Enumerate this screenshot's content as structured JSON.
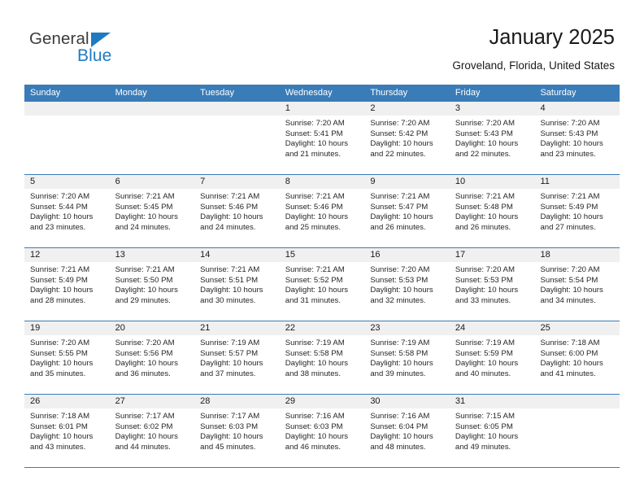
{
  "logo": {
    "word1": "General",
    "word2": "Blue",
    "triangle_color": "#1f7ac0",
    "word1_color": "#3b3b3b",
    "word2_color": "#1f7ac0"
  },
  "header": {
    "title": "January 2025",
    "subtitle": "Groveland, Florida, United States"
  },
  "theme": {
    "header_bar": "#3a7cb8",
    "date_band": "#f0f0f0",
    "text": "#262626"
  },
  "weekdays": [
    "Sunday",
    "Monday",
    "Tuesday",
    "Wednesday",
    "Thursday",
    "Friday",
    "Saturday"
  ],
  "weeks": [
    [
      {
        "day": "",
        "lines": []
      },
      {
        "day": "",
        "lines": []
      },
      {
        "day": "",
        "lines": []
      },
      {
        "day": "1",
        "lines": [
          "Sunrise: 7:20 AM",
          "Sunset: 5:41 PM",
          "Daylight: 10 hours",
          "and 21 minutes."
        ]
      },
      {
        "day": "2",
        "lines": [
          "Sunrise: 7:20 AM",
          "Sunset: 5:42 PM",
          "Daylight: 10 hours",
          "and 22 minutes."
        ]
      },
      {
        "day": "3",
        "lines": [
          "Sunrise: 7:20 AM",
          "Sunset: 5:43 PM",
          "Daylight: 10 hours",
          "and 22 minutes."
        ]
      },
      {
        "day": "4",
        "lines": [
          "Sunrise: 7:20 AM",
          "Sunset: 5:43 PM",
          "Daylight: 10 hours",
          "and 23 minutes."
        ]
      }
    ],
    [
      {
        "day": "5",
        "lines": [
          "Sunrise: 7:20 AM",
          "Sunset: 5:44 PM",
          "Daylight: 10 hours",
          "and 23 minutes."
        ]
      },
      {
        "day": "6",
        "lines": [
          "Sunrise: 7:21 AM",
          "Sunset: 5:45 PM",
          "Daylight: 10 hours",
          "and 24 minutes."
        ]
      },
      {
        "day": "7",
        "lines": [
          "Sunrise: 7:21 AM",
          "Sunset: 5:46 PM",
          "Daylight: 10 hours",
          "and 24 minutes."
        ]
      },
      {
        "day": "8",
        "lines": [
          "Sunrise: 7:21 AM",
          "Sunset: 5:46 PM",
          "Daylight: 10 hours",
          "and 25 minutes."
        ]
      },
      {
        "day": "9",
        "lines": [
          "Sunrise: 7:21 AM",
          "Sunset: 5:47 PM",
          "Daylight: 10 hours",
          "and 26 minutes."
        ]
      },
      {
        "day": "10",
        "lines": [
          "Sunrise: 7:21 AM",
          "Sunset: 5:48 PM",
          "Daylight: 10 hours",
          "and 26 minutes."
        ]
      },
      {
        "day": "11",
        "lines": [
          "Sunrise: 7:21 AM",
          "Sunset: 5:49 PM",
          "Daylight: 10 hours",
          "and 27 minutes."
        ]
      }
    ],
    [
      {
        "day": "12",
        "lines": [
          "Sunrise: 7:21 AM",
          "Sunset: 5:49 PM",
          "Daylight: 10 hours",
          "and 28 minutes."
        ]
      },
      {
        "day": "13",
        "lines": [
          "Sunrise: 7:21 AM",
          "Sunset: 5:50 PM",
          "Daylight: 10 hours",
          "and 29 minutes."
        ]
      },
      {
        "day": "14",
        "lines": [
          "Sunrise: 7:21 AM",
          "Sunset: 5:51 PM",
          "Daylight: 10 hours",
          "and 30 minutes."
        ]
      },
      {
        "day": "15",
        "lines": [
          "Sunrise: 7:21 AM",
          "Sunset: 5:52 PM",
          "Daylight: 10 hours",
          "and 31 minutes."
        ]
      },
      {
        "day": "16",
        "lines": [
          "Sunrise: 7:20 AM",
          "Sunset: 5:53 PM",
          "Daylight: 10 hours",
          "and 32 minutes."
        ]
      },
      {
        "day": "17",
        "lines": [
          "Sunrise: 7:20 AM",
          "Sunset: 5:53 PM",
          "Daylight: 10 hours",
          "and 33 minutes."
        ]
      },
      {
        "day": "18",
        "lines": [
          "Sunrise: 7:20 AM",
          "Sunset: 5:54 PM",
          "Daylight: 10 hours",
          "and 34 minutes."
        ]
      }
    ],
    [
      {
        "day": "19",
        "lines": [
          "Sunrise: 7:20 AM",
          "Sunset: 5:55 PM",
          "Daylight: 10 hours",
          "and 35 minutes."
        ]
      },
      {
        "day": "20",
        "lines": [
          "Sunrise: 7:20 AM",
          "Sunset: 5:56 PM",
          "Daylight: 10 hours",
          "and 36 minutes."
        ]
      },
      {
        "day": "21",
        "lines": [
          "Sunrise: 7:19 AM",
          "Sunset: 5:57 PM",
          "Daylight: 10 hours",
          "and 37 minutes."
        ]
      },
      {
        "day": "22",
        "lines": [
          "Sunrise: 7:19 AM",
          "Sunset: 5:58 PM",
          "Daylight: 10 hours",
          "and 38 minutes."
        ]
      },
      {
        "day": "23",
        "lines": [
          "Sunrise: 7:19 AM",
          "Sunset: 5:58 PM",
          "Daylight: 10 hours",
          "and 39 minutes."
        ]
      },
      {
        "day": "24",
        "lines": [
          "Sunrise: 7:19 AM",
          "Sunset: 5:59 PM",
          "Daylight: 10 hours",
          "and 40 minutes."
        ]
      },
      {
        "day": "25",
        "lines": [
          "Sunrise: 7:18 AM",
          "Sunset: 6:00 PM",
          "Daylight: 10 hours",
          "and 41 minutes."
        ]
      }
    ],
    [
      {
        "day": "26",
        "lines": [
          "Sunrise: 7:18 AM",
          "Sunset: 6:01 PM",
          "Daylight: 10 hours",
          "and 43 minutes."
        ]
      },
      {
        "day": "27",
        "lines": [
          "Sunrise: 7:17 AM",
          "Sunset: 6:02 PM",
          "Daylight: 10 hours",
          "and 44 minutes."
        ]
      },
      {
        "day": "28",
        "lines": [
          "Sunrise: 7:17 AM",
          "Sunset: 6:03 PM",
          "Daylight: 10 hours",
          "and 45 minutes."
        ]
      },
      {
        "day": "29",
        "lines": [
          "Sunrise: 7:16 AM",
          "Sunset: 6:03 PM",
          "Daylight: 10 hours",
          "and 46 minutes."
        ]
      },
      {
        "day": "30",
        "lines": [
          "Sunrise: 7:16 AM",
          "Sunset: 6:04 PM",
          "Daylight: 10 hours",
          "and 48 minutes."
        ]
      },
      {
        "day": "31",
        "lines": [
          "Sunrise: 7:15 AM",
          "Sunset: 6:05 PM",
          "Daylight: 10 hours",
          "and 49 minutes."
        ]
      },
      {
        "day": "",
        "lines": []
      }
    ]
  ]
}
